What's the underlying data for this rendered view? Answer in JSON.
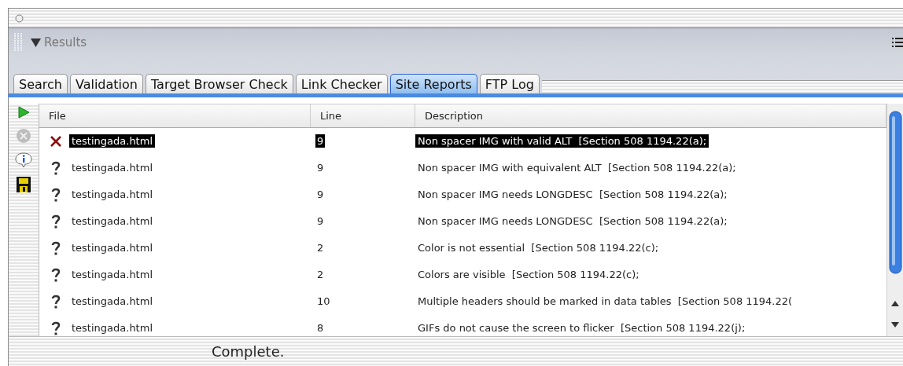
{
  "panel": {
    "title": "Results"
  },
  "tabs": [
    {
      "label": "Search",
      "selected": false
    },
    {
      "label": "Validation",
      "selected": false
    },
    {
      "label": "Target Browser Check",
      "selected": false
    },
    {
      "label": "Link Checker",
      "selected": false
    },
    {
      "label": "Site Reports",
      "selected": true
    },
    {
      "label": "FTP Log",
      "selected": false
    }
  ],
  "table": {
    "columns": [
      "File",
      "Line",
      "Description"
    ],
    "rows": [
      {
        "kind": "error",
        "selected": true,
        "file": "testingada.html",
        "line": "9",
        "description": "Non spacer IMG with valid ALT  [Section 508 1194.22(a);"
      },
      {
        "kind": "question",
        "selected": false,
        "file": "testingada.html",
        "line": "9",
        "description": "Non spacer IMG with equivalent ALT  [Section 508 1194.22(a);"
      },
      {
        "kind": "question",
        "selected": false,
        "file": "testingada.html",
        "line": "9",
        "description": "Non spacer IMG needs LONGDESC  [Section 508 1194.22(a);"
      },
      {
        "kind": "question",
        "selected": false,
        "file": "testingada.html",
        "line": "9",
        "description": "Non spacer IMG needs LONGDESC  [Section 508 1194.22(a);"
      },
      {
        "kind": "question",
        "selected": false,
        "file": "testingada.html",
        "line": "2",
        "description": "Color is not essential  [Section 508 1194.22(c);"
      },
      {
        "kind": "question",
        "selected": false,
        "file": "testingada.html",
        "line": "2",
        "description": "Colors are visible  [Section 508 1194.22(c);"
      },
      {
        "kind": "question",
        "selected": false,
        "file": "testingada.html",
        "line": "10",
        "description": "Multiple headers should be marked in data tables  [Section 508 1194.22("
      },
      {
        "kind": "question",
        "selected": false,
        "file": "testingada.html",
        "line": "8",
        "description": "GIFs do not cause the screen to flicker  [Section 508 1194.22(j);"
      }
    ]
  },
  "status_bar": "Complete."
}
